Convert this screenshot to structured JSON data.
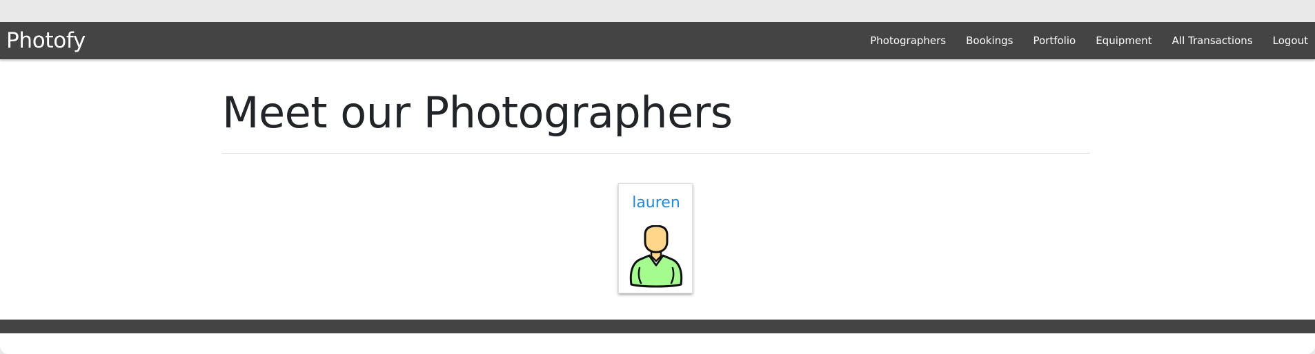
{
  "navbar": {
    "brand": "Photofy",
    "links": [
      {
        "label": "Photographers"
      },
      {
        "label": "Bookings"
      },
      {
        "label": "Portfolio"
      },
      {
        "label": "Equipment"
      },
      {
        "label": "All Transactions"
      },
      {
        "label": "Logout"
      }
    ]
  },
  "main": {
    "title": "Meet our Photographers",
    "photographers": [
      {
        "name": "lauren",
        "avatar_icon": "person-avatar-icon"
      }
    ]
  },
  "colors": {
    "navbar_bg": "#444444",
    "link_blue": "#1e88e5",
    "avatar_skin": "#ffd68a",
    "avatar_shirt": "#a4fc8f"
  }
}
